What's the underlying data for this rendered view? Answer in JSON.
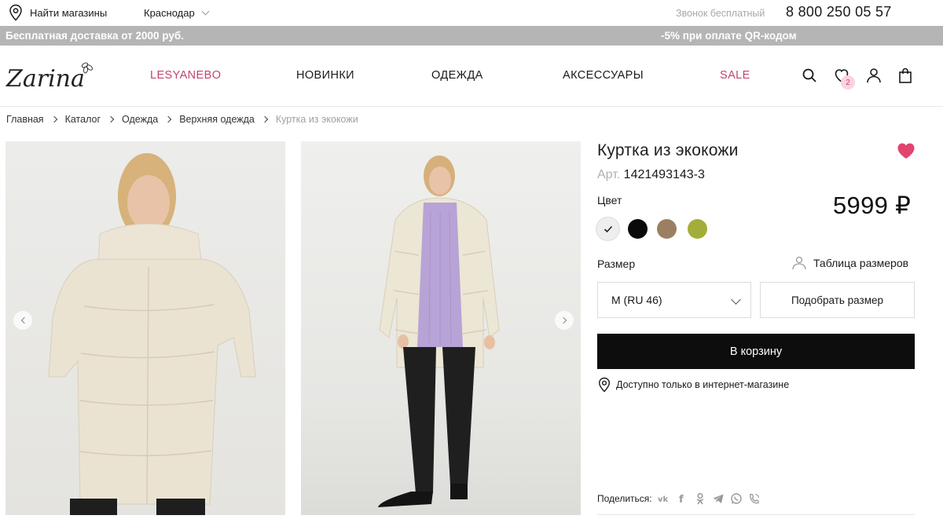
{
  "topbar": {
    "store_finder": "Найти магазины",
    "city": "Краснодар",
    "call_note": "Звонок бесплатный",
    "phone": "8 800 250 05 57"
  },
  "promo": {
    "left": "Бесплатная доставка от 2000 руб.",
    "right": "-5% при оплате QR-кодом"
  },
  "header": {
    "logo_text": "Zarina",
    "nav": [
      "LESYANEBO",
      "НОВИНКИ",
      "ОДЕЖДА",
      "АКСЕССУАРЫ",
      "SALE"
    ],
    "favorites_count": "2",
    "icons": [
      "search-icon",
      "heart-icon",
      "user-icon",
      "bag-icon"
    ]
  },
  "breadcrumb": [
    "Главная",
    "Каталог",
    "Одежда",
    "Верхняя одежда",
    "Куртка из экокожи"
  ],
  "product": {
    "title": "Куртка из экокожи",
    "sku_label": "Арт.",
    "sku": "1421493143-3",
    "color_label": "Цвет",
    "price": "5999 ₽",
    "colors": [
      "#ece9e2",
      "#0a0a0a",
      "#9c7e62",
      "#a3ae3a"
    ],
    "selected_color_index": 0,
    "size_label": "Размер",
    "size_table": "Таблица размеров",
    "selected_size": "M (RU 46)",
    "pick_size": "Подобрать размер",
    "add_to_cart": "В корзину",
    "availability": "Доступно только в интернет-магазине",
    "share_label": "Поделиться:",
    "share_icons": [
      "vk-icon",
      "facebook-icon",
      "odnoklassniki-icon",
      "telegram-icon",
      "whatsapp-icon",
      "viber-icon"
    ]
  },
  "colors": {
    "accent_pink": "#c2456b",
    "promo_bg": "#b5b5b5",
    "cart_bg": "#0d0d0d"
  }
}
